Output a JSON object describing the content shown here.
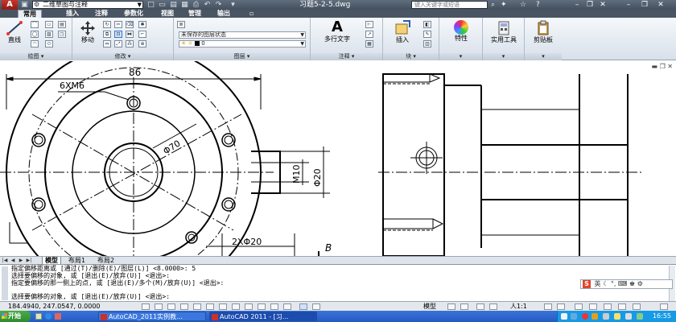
{
  "app": {
    "logo_text": "A",
    "workspace": "二维草图与注释",
    "document_title": "习题5-2-5.dwg",
    "help_search_placeholder": "键入关键字或短语"
  },
  "ribbon_tabs": [
    "常用",
    "插入",
    "注释",
    "参数化",
    "视图",
    "管理",
    "输出"
  ],
  "ribbon": {
    "draw": {
      "line_label": "直线",
      "panel_title": "绘图"
    },
    "modify": {
      "move_label": "移动",
      "panel_title": "修改"
    },
    "layers": {
      "layer_state": "未保存的图层状态",
      "current_layer": "0",
      "panel_title": "图层"
    },
    "annotation": {
      "mtext_label": "多行文字",
      "panel_title": "注释"
    },
    "block": {
      "insert_label": "插入",
      "panel_title": "块"
    },
    "properties_label": "特性",
    "utilities_label": "实用工具",
    "clipboard_label": "剪贴板"
  },
  "drawing": {
    "dim_86": "86",
    "dim_holes": "6XM6",
    "dim_d70": "Φ70",
    "dim_m10": "M10",
    "dim_d20": "Φ20",
    "dim_2xd20": "2XΦ20",
    "view_label": "B"
  },
  "layout_tabs": [
    "模型",
    "布局1",
    "布局2"
  ],
  "command_lines": [
    "指定偏移距离或 [通过(T)/删除(E)/图层(L)] <8.0000>:  5",
    "选择要偏移的对象, 或 [退出(E)/放弃(U)] <退出>:",
    "指定要偏移的那一侧上的点, 或 [退出(E)/多个(M)/放弃(U)] <退出>:",
    "选择要偏移的对象, 或 [退出(E)/放弃(U)] <退出>:"
  ],
  "ime": {
    "logo": "S",
    "lang": "英"
  },
  "status": {
    "coords": "184.4940,  247.0547,  0.0000",
    "model": "模型",
    "annotation_scale": "人1:1"
  },
  "taskbar": {
    "start_label": "开始",
    "tasks": [
      "AutoCAD_2011实例教...",
      "AutoCAD 2011 - [习..."
    ],
    "clock": "16:55"
  }
}
